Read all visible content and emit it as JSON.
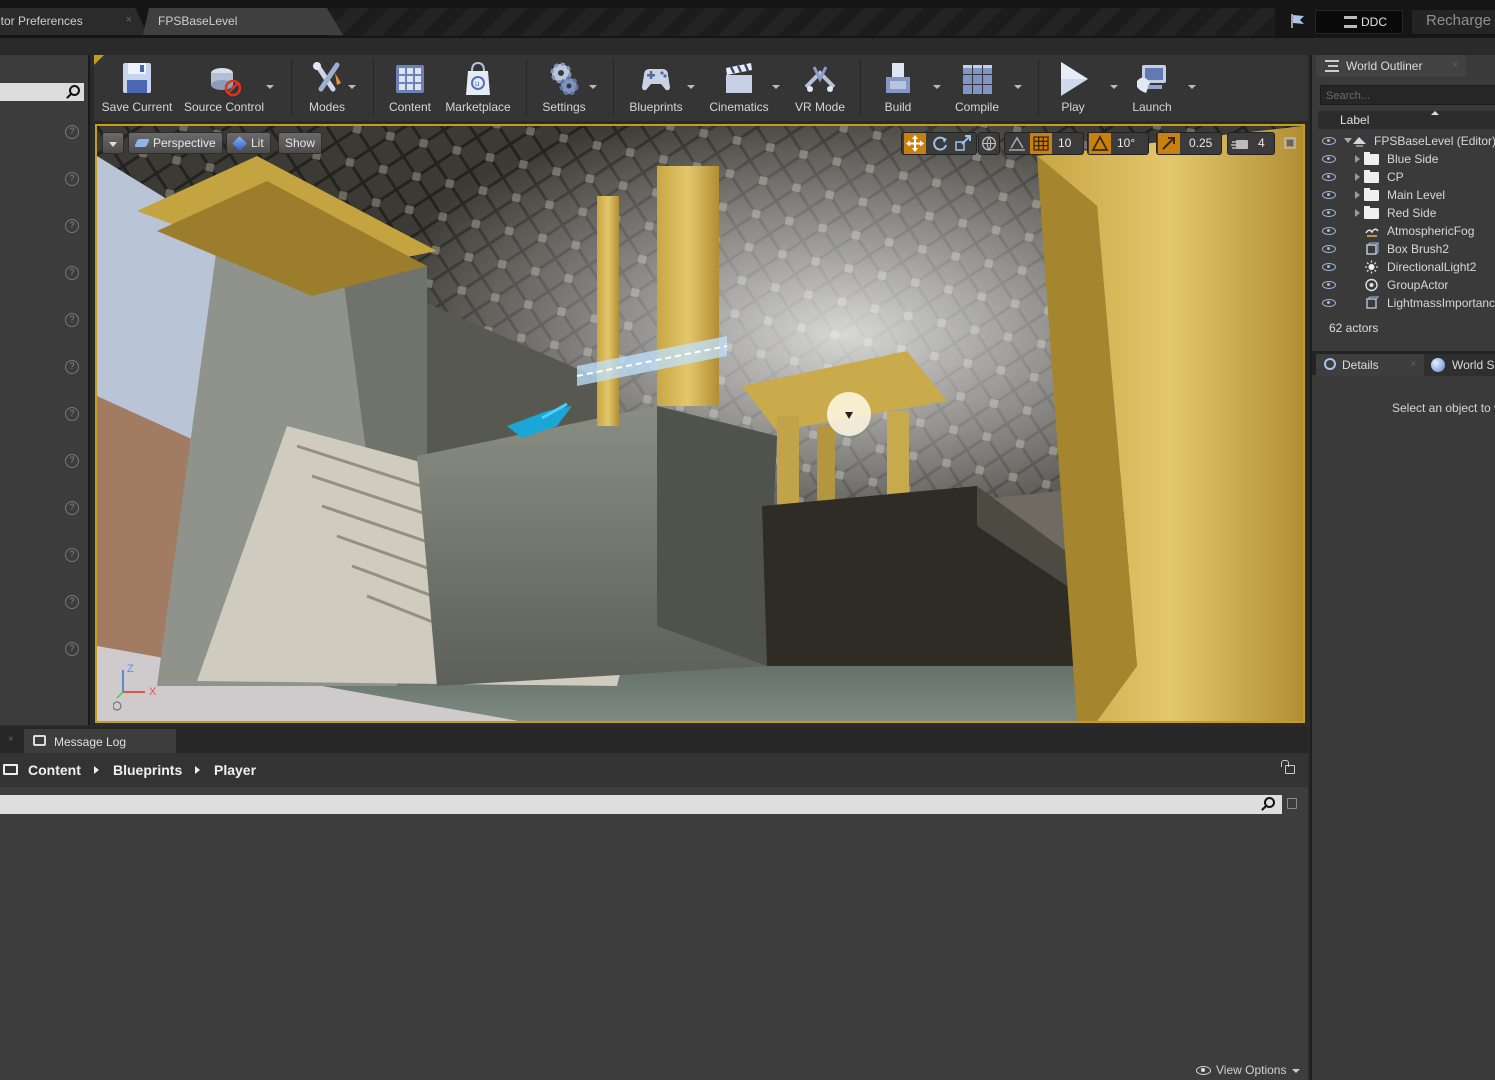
{
  "document_tabs": [
    {
      "label": "itor Preferences",
      "close": "×"
    },
    {
      "label": "FPSBaseLevel"
    }
  ],
  "titlebar": {
    "ddc_label": "DDC",
    "project_name": "Recharge"
  },
  "toolbar": {
    "items": [
      {
        "label": "Save Current",
        "icon": "floppy-disk-icon"
      },
      {
        "label": "Source Control",
        "icon": "source-control-icon"
      },
      {
        "label": "Modes",
        "icon": "modes-icon"
      },
      {
        "label": "Content",
        "icon": "content-grid-icon"
      },
      {
        "label": "Marketplace",
        "icon": "marketplace-bag-icon"
      },
      {
        "label": "Settings",
        "icon": "gears-icon"
      },
      {
        "label": "Blueprints",
        "icon": "gamepad-icon"
      },
      {
        "label": "Cinematics",
        "icon": "clapperboard-icon"
      },
      {
        "label": "VR Mode",
        "icon": "vr-headset-icon"
      },
      {
        "label": "Build",
        "icon": "build-blocks-icon"
      },
      {
        "label": "Compile",
        "icon": "compile-cubes-icon"
      },
      {
        "label": "Play",
        "icon": "play-icon"
      },
      {
        "label": "Launch",
        "icon": "launch-icon"
      }
    ]
  },
  "viewport": {
    "perspective_label": "Perspective",
    "lit_label": "Lit",
    "show_label": "Show",
    "grid_snap": "10",
    "rotation_snap": "10°",
    "scale_snap": "0.25",
    "camera_speed": "4",
    "axis_labels": {
      "z": "Z",
      "x": "X"
    }
  },
  "world_outliner": {
    "tab_label": "World Outliner",
    "close": "×",
    "search_placeholder": "Search...",
    "column_label": "Label",
    "rows": [
      {
        "label": "FPSBaseLevel (Editor)",
        "kind": "level"
      },
      {
        "label": "Blue Side",
        "kind": "folder"
      },
      {
        "label": "CP",
        "kind": "folder"
      },
      {
        "label": "Main Level",
        "kind": "folder"
      },
      {
        "label": "Red Side",
        "kind": "folder"
      },
      {
        "label": "AtmosphericFog",
        "kind": "fog"
      },
      {
        "label": "Box Brush2",
        "kind": "brush"
      },
      {
        "label": "DirectionalLight2",
        "kind": "light"
      },
      {
        "label": "GroupActor",
        "kind": "group"
      },
      {
        "label": "LightmassImportanc",
        "kind": "volume"
      }
    ],
    "actor_count": "62 actors"
  },
  "details": {
    "tab_label": "Details",
    "close": "×",
    "world_settings_label": "World Se",
    "empty_message": "Select an object to v"
  },
  "bottom": {
    "close": "×",
    "message_log_label": "Message Log",
    "breadcrumb": [
      "Content",
      "Blueprints",
      "Player"
    ],
    "view_options_label": "View Options"
  },
  "colors": {
    "accent_gold": "#c49d1a",
    "panel_bg": "#3a3a3a",
    "eye_blue": "#9fb7d8"
  }
}
